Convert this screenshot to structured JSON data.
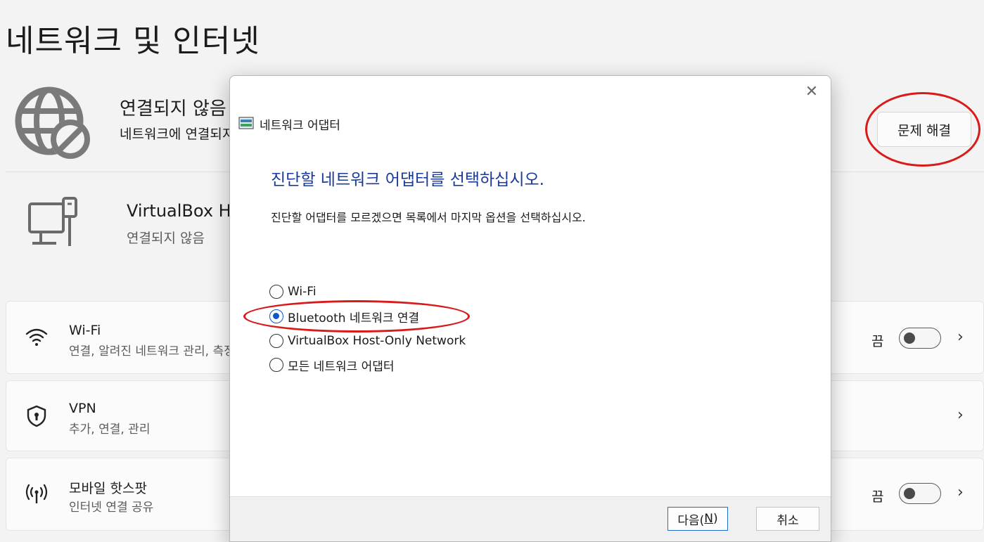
{
  "page": {
    "title": "네트워크 및 인터넷"
  },
  "status": {
    "title": "연결되지 않음",
    "subtitle": "네트워크에 연결되지 않음",
    "troubleshoot_label": "문제 해결"
  },
  "adapter": {
    "name": "VirtualBox Host-Only Network",
    "status": "연결되지 않음"
  },
  "cards": [
    {
      "title": "Wi-Fi",
      "subtitle": "연결, 알려진 네트워크 관리, 측정 네트워크",
      "toggle_label": "끔",
      "toggle_on": false,
      "icon": "wifi-icon"
    },
    {
      "title": "VPN",
      "subtitle": "추가, 연결, 관리",
      "icon": "shield-icon"
    },
    {
      "title": "모바일 핫스팟",
      "subtitle": "인터넷 연결 공유",
      "toggle_label": "끔",
      "toggle_on": false,
      "icon": "hotspot-icon"
    }
  ],
  "dialog": {
    "header": "네트워크 어댑터",
    "instruction": "진단할 네트워크 어댑터를 선택하십시오.",
    "hint": "진단할 어댑터를 모르겠으면 목록에서 마지막 옵션을 선택하십시오.",
    "options": [
      {
        "label": "Wi-Fi",
        "selected": false
      },
      {
        "label": "Bluetooth 네트워크 연결",
        "selected": true
      },
      {
        "label": "VirtualBox Host-Only Network",
        "selected": false
      },
      {
        "label": "모든 네트워크 어댑터",
        "selected": false
      }
    ],
    "next_label": "다음(",
    "next_mnemonic": "N",
    "next_close": ")",
    "cancel_label": "취소"
  },
  "colors": {
    "accent": "#0a58c7",
    "instruction_text": "#1a3b9c",
    "annotation": "#d91a1a"
  }
}
